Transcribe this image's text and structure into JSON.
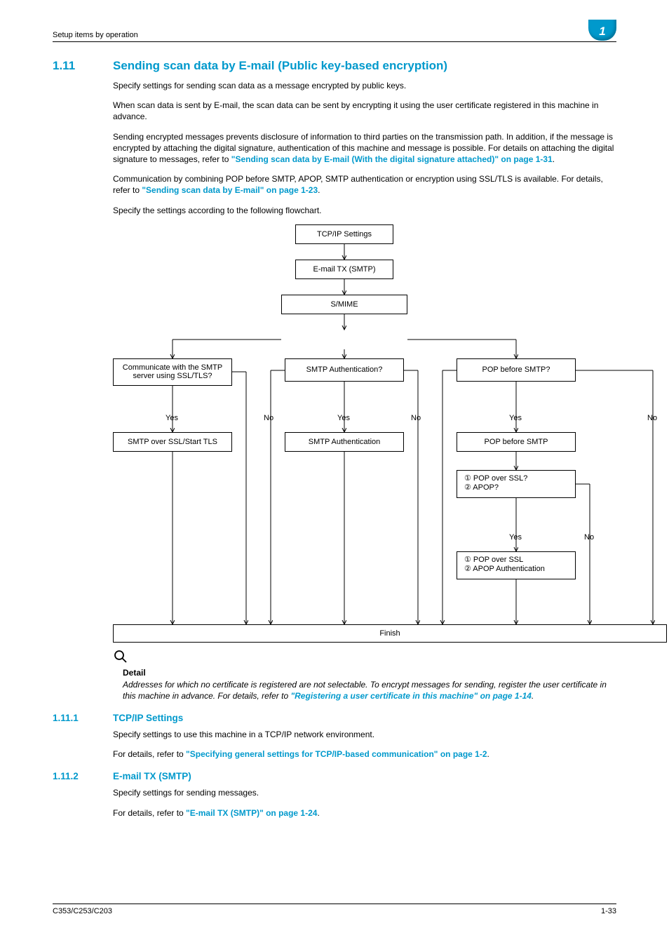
{
  "header": {
    "breadcrumb": "Setup items by operation",
    "chapter": "1"
  },
  "section": {
    "number": "1.11",
    "title": "Sending scan data by E-mail (Public key-based encryption)",
    "p1": "Specify settings for sending scan data as a message encrypted by public keys.",
    "p2": "When scan data is sent by E-mail, the scan data can be sent by encrypting it using the user certificate registered in this machine in advance.",
    "p3a": "Sending encrypted messages prevents disclosure of information to third parties on the transmission path. In addition, if the message is encrypted by attaching the digital signature, authentication of this machine and message is possible. For details on attaching the digital signature to messages, refer to ",
    "link1": "\"Sending scan data by E-mail (With the digital signature attached)\" on page 1-31",
    "p3c": ".",
    "p4a": "Communication by combining POP before SMTP, APOP, SMTP authentication or encryption using SSL/TLS is available. For details, refer to ",
    "link2": "\"Sending scan data by E-mail\" on page 1-23",
    "p4c": ".",
    "p5": "Specify the settings according to the following flowchart."
  },
  "flowchart": {
    "tcp": "TCP/IP Settings",
    "emailtx": "E-mail TX (SMTP)",
    "smime": "S/MIME",
    "q1": "Communicate with the SMTP server using SSL/TLS?",
    "q2": "SMTP Authentication?",
    "q3": "POP before SMTP?",
    "yes": "Yes",
    "no": "No",
    "a1": "SMTP over SSL/Start TLS",
    "a2": "SMTP Authentication",
    "a3": "POP before SMTP",
    "q4a": "① POP over SSL?",
    "q4b": "② APOP?",
    "a4a": "① POP over SSL",
    "a4b": "② APOP Authentication",
    "finish": "Finish"
  },
  "detail": {
    "title": "Detail",
    "text_a": "Addresses for which no certificate is registered are not selectable. To encrypt messages for sending, register the user certificate in this machine in advance. For details, refer to ",
    "link": "\"Registering a user certificate in this machine\" on page 1-14",
    "text_c": "."
  },
  "sub1": {
    "number": "1.11.1",
    "title": "TCP/IP Settings",
    "p": "Specify settings to use this machine in a TCP/IP network environment.",
    "d_pre": "For details, refer to ",
    "link": "\"Specifying general settings for TCP/IP-based communication\" on page 1-2",
    "d_post": "."
  },
  "sub2": {
    "number": "1.11.2",
    "title": "E-mail TX (SMTP)",
    "p": "Specify settings for sending messages.",
    "d_pre": "For details, refer to ",
    "link": "\"E-mail TX (SMTP)\" on page 1-24",
    "d_post": "."
  },
  "footer": {
    "model": "C353/C253/C203",
    "page": "1-33"
  }
}
